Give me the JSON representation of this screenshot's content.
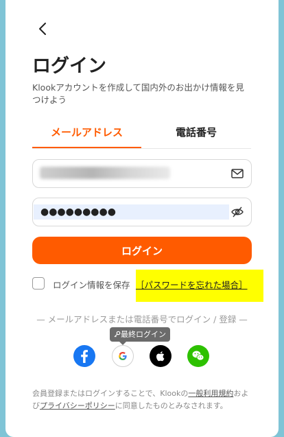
{
  "page": {
    "title": "ログイン",
    "subtitle": "Klookアカウントを作成して国内外のお出かけ情報を見つけよう"
  },
  "tabs": [
    {
      "label": "メールアドレス",
      "active": true
    },
    {
      "label": "電話番号",
      "active": false
    }
  ],
  "email": {
    "value": "●●●●●●●●●●●●●●●●●●●",
    "icon": "mail-icon"
  },
  "password": {
    "value": "●●●●●●●●●",
    "icon": "eye-off-icon"
  },
  "login_button": "ログイン",
  "remember": {
    "label": "ログイン情報を保存",
    "checked": false
  },
  "forgot": {
    "label": "［パスワードを忘れた場合］"
  },
  "divider": "— メールアドレスまたは電話番号でログイン / 登録 —",
  "tooltip": "最終ログイン",
  "social": [
    {
      "name": "facebook",
      "icon": "facebook-icon",
      "color": "#1877f2"
    },
    {
      "name": "google",
      "icon": "google-icon",
      "color": "#ffffff"
    },
    {
      "name": "apple",
      "icon": "apple-icon",
      "color": "#000000"
    },
    {
      "name": "wechat",
      "icon": "wechat-icon",
      "color": "#2dc100"
    }
  ],
  "terms": {
    "prefix": "会員登録またはログインすることで、Klookの",
    "link1": "一般利用規約",
    "middle": "および",
    "link2": "プライバシーポリシー",
    "suffix": "に同意したものとみなされます。"
  },
  "colors": {
    "accent": "#ff5b00",
    "highlight": "#ffff00"
  }
}
